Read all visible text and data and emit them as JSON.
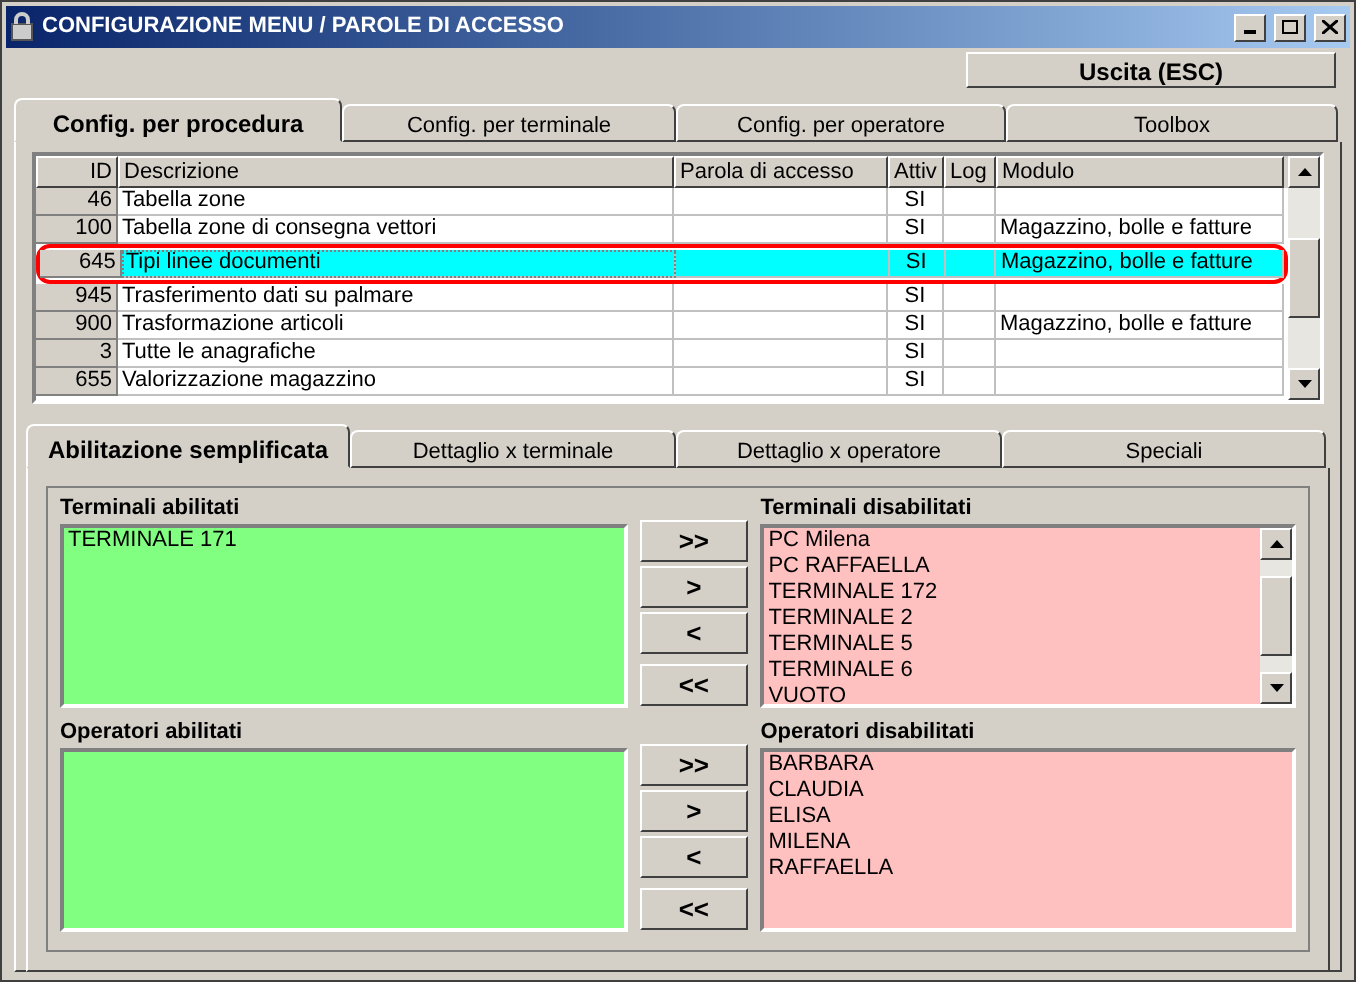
{
  "window": {
    "title": "CONFIGURAZIONE MENU / PAROLE DI ACCESSO"
  },
  "exit_button": "Uscita (ESC)",
  "tabs": [
    {
      "label": "Config. per procedura",
      "selected": true
    },
    {
      "label": "Config. per terminale",
      "selected": false
    },
    {
      "label": "Config. per operatore",
      "selected": false
    },
    {
      "label": "Toolbox",
      "selected": false
    }
  ],
  "table": {
    "columns": [
      "ID",
      "Descrizione",
      "Parola di accesso",
      "Attiv",
      "Log",
      "Modulo"
    ],
    "rows": [
      {
        "id": "46",
        "description": "Tabella zone",
        "active": "SI",
        "module": "",
        "selected": false
      },
      {
        "id": "100",
        "description": "Tabella zone di consegna vettori",
        "active": "SI",
        "module": "Magazzino, bolle e fatture",
        "selected": false
      },
      {
        "id": "645",
        "description": "Tipi linee documenti",
        "active": "SI",
        "module": "Magazzino, bolle e fatture",
        "selected": true
      },
      {
        "id": "945",
        "description": "Trasferimento dati su palmare",
        "active": "SI",
        "module": "",
        "selected": false
      },
      {
        "id": "900",
        "description": "Trasformazione articoli",
        "active": "SI",
        "module": "Magazzino, bolle e fatture",
        "selected": false
      },
      {
        "id": "3",
        "description": "Tutte le anagrafiche",
        "active": "SI",
        "module": "",
        "selected": false
      },
      {
        "id": "655",
        "description": "Valorizzazione magazzino",
        "active": "SI",
        "module": "",
        "selected": false
      }
    ]
  },
  "subtabs": [
    {
      "label": "Abilitazione semplificata",
      "selected": true
    },
    {
      "label": "Dettaglio x terminale",
      "selected": false
    },
    {
      "label": "Dettaglio x operatore",
      "selected": false
    },
    {
      "label": "Speciali",
      "selected": false
    }
  ],
  "sections": [
    {
      "enabled_label": "Terminali abilitati",
      "enabled_items": [
        "TERMINALE 171"
      ],
      "disabled_label": "Terminali disabilitati",
      "disabled_items": [
        "PC Milena",
        "PC RAFFAELLA",
        "TERMINALE 172",
        "TERMINALE 2",
        "TERMINALE 5",
        "TERMINALE 6",
        "VUOTO"
      ],
      "disabled_scrollbar": true,
      "buttons": [
        ">>",
        ">",
        "<",
        "<<"
      ]
    },
    {
      "enabled_label": "Operatori abilitati",
      "disabled_label": "Operatori disabilitati",
      "disabled_items": [
        "BARBARA",
        "CLAUDIA",
        "ELISA",
        "MILENA",
        "RAFFAELLA"
      ],
      "disabled_scrollbar": false,
      "buttons": [
        ">>",
        ">",
        "<",
        "<<"
      ]
    }
  ]
}
